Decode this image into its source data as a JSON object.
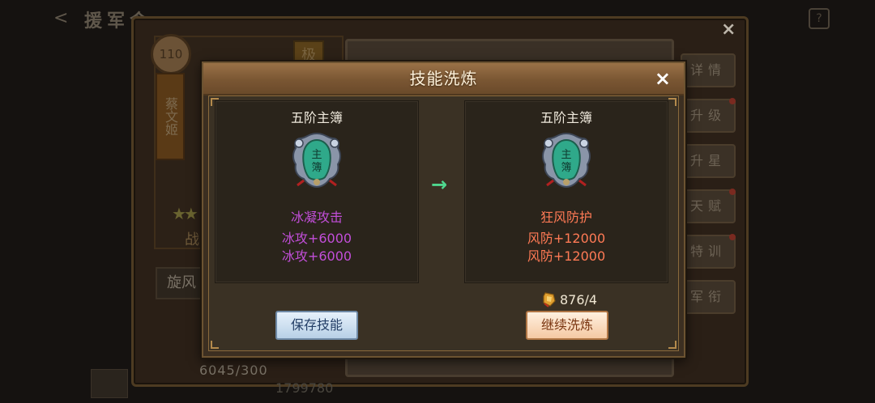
{
  "background": {
    "screen_title": "援军令",
    "help_label": "?",
    "close_label": "×",
    "hero": {
      "level": "110",
      "name": "蔡文姬",
      "tag": "极",
      "rank_label": "战",
      "skill_tab": "旋风"
    },
    "side_buttons": [
      "详情",
      "升级",
      "升星",
      "天赋",
      "特训",
      "军衔"
    ],
    "count_text": "6045/300",
    "bottom_number": "1799780"
  },
  "dialog": {
    "title": "技能洗炼",
    "close_label": "×",
    "left_card": {
      "name": "五阶主簿",
      "effect": "冰凝攻击",
      "stats": [
        "冰攻+6000",
        "冰攻+6000"
      ]
    },
    "right_card": {
      "name": "五阶主簿",
      "effect": "狂风防护",
      "stats": [
        "风防+12000",
        "风防+12000"
      ]
    },
    "arrow": "→",
    "cost": "876/4",
    "buttons": {
      "save": "保存技能",
      "continue": "继续洗炼"
    },
    "colors": {
      "left_effect": "#c24ed9",
      "right_effect": "#ff7a55",
      "arrow": "#4fd78f",
      "header": "#8a6440"
    }
  }
}
